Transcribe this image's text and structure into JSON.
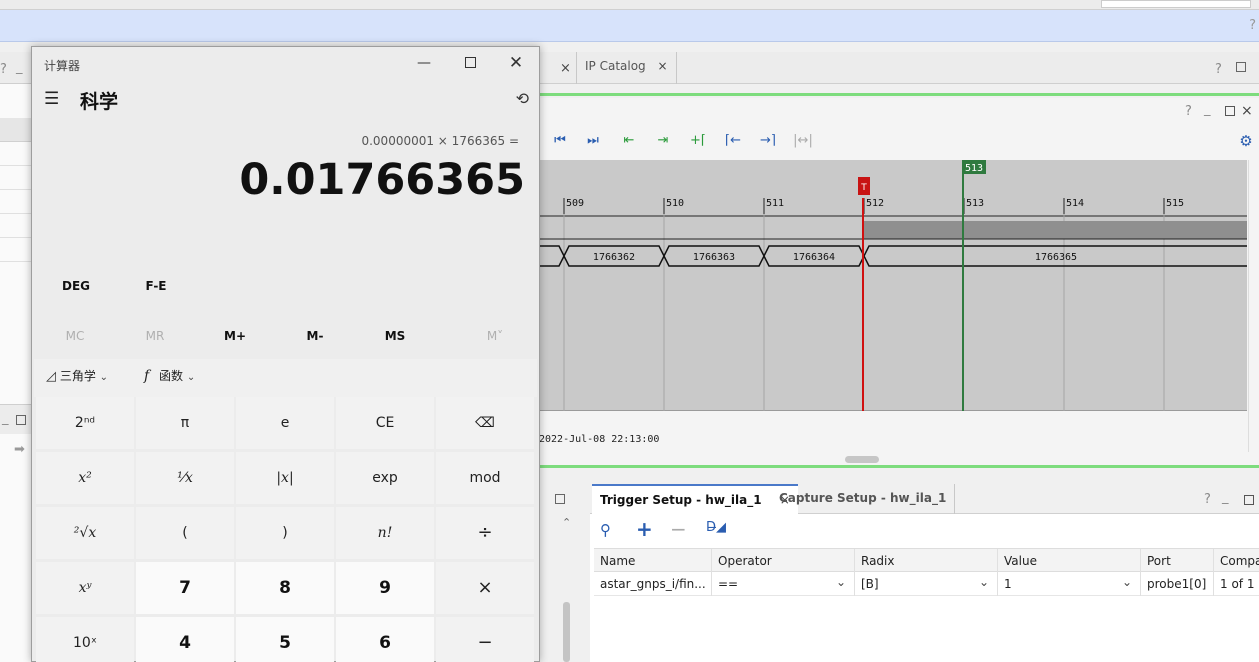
{
  "ide": {
    "left_tab_q": "?",
    "left_tab_min": "_",
    "ip_catalog_tab": "IP Catalog",
    "close_x": "×",
    "help_q": "?",
    "wave_header_controls": [
      "?",
      "_",
      "□",
      "×"
    ],
    "timestamp": "2022-Jul-08 22:13:00",
    "marker_label": "513",
    "trigger_marker_label": "T",
    "ticks": [
      "509",
      "510",
      "511",
      "512",
      "513",
      "514",
      "515"
    ],
    "bus_values": [
      "1766362",
      "1766363",
      "1766364",
      "1766365"
    ],
    "bottom_tabs": {
      "trigger": "Trigger Setup - hw_ila_1",
      "capture": "Capture Setup - hw_ila_1"
    },
    "table": {
      "headers": [
        "Name",
        "Operator",
        "Radix",
        "Value",
        "Port",
        "Compa"
      ],
      "rows": [
        [
          "astar_gnps_i/fin...",
          "==",
          "[B]",
          "1",
          "probe1[0]",
          "1 of 1"
        ]
      ]
    }
  },
  "calculator": {
    "title": "计算器",
    "mode": "科学",
    "expression": "0.00000001 × 1766365 =",
    "result": "0.01766365",
    "angle_btn": "DEG",
    "fe_btn": "F-E",
    "memory": [
      "MC",
      "MR",
      "M+",
      "M-",
      "MS",
      "M˅"
    ],
    "trig_menu": "三角学",
    "func_menu": "函数",
    "keys": [
      [
        "2ⁿᵈ",
        "π",
        "e",
        "CE",
        "⌫"
      ],
      [
        "x²",
        "¹⁄x",
        "|x|",
        "exp",
        "mod"
      ],
      [
        "²√x",
        "(",
        ")",
        "n!",
        "÷"
      ],
      [
        "xʸ",
        "7",
        "8",
        "9",
        "×"
      ],
      [
        "10ˣ",
        "4",
        "5",
        "6",
        "−"
      ]
    ]
  }
}
